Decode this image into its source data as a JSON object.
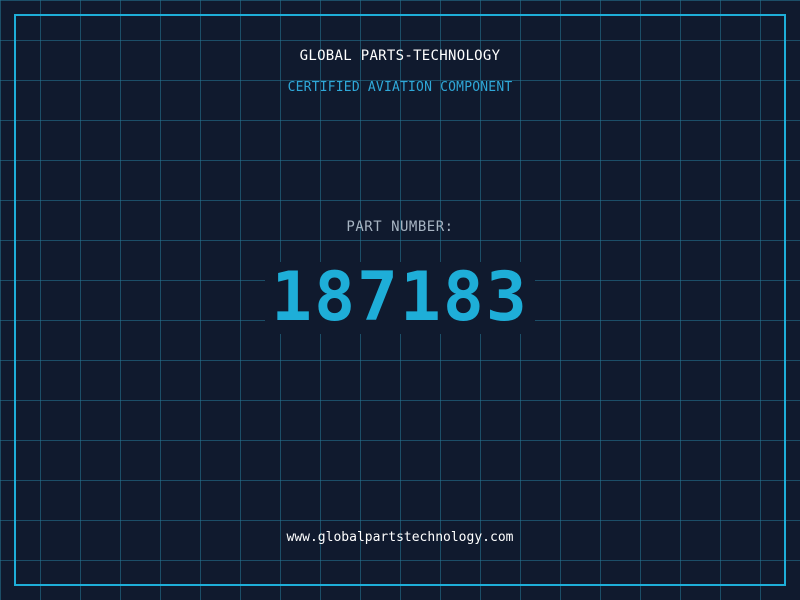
{
  "header": {
    "company": "GLOBAL PARTS-TECHNOLOGY",
    "subtitle": "CERTIFIED AVIATION COMPONENT"
  },
  "part": {
    "label": "PART NUMBER:",
    "number": "187183"
  },
  "footer": {
    "website": "www.globalpartstechnology.com"
  },
  "colors": {
    "background": "#101a2e",
    "accent": "#1eaed8",
    "grid": "#26789a",
    "label": "#a7b4c2",
    "text": "#ffffff"
  }
}
